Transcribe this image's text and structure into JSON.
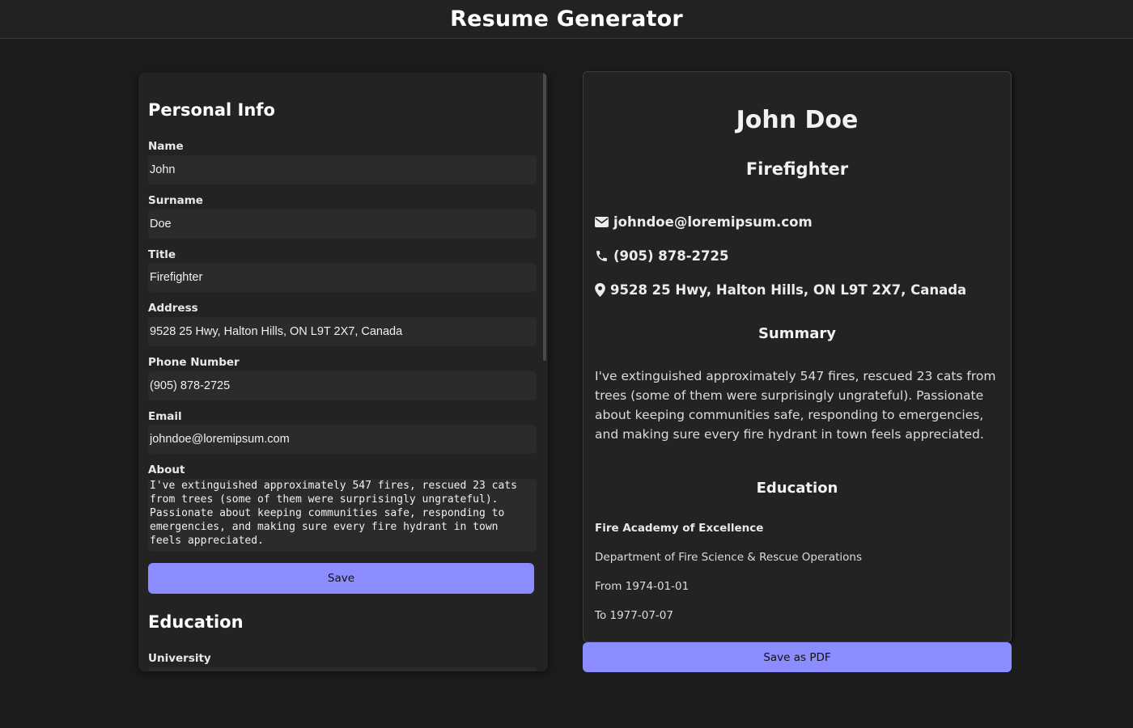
{
  "app": {
    "title": "Resume Generator"
  },
  "form": {
    "personal": {
      "heading": "Personal Info",
      "name_label": "Name",
      "name_value": "John",
      "surname_label": "Surname",
      "surname_value": "Doe",
      "title_label": "Title",
      "title_value": "Firefighter",
      "address_label": "Address",
      "address_value": "9528 25 Hwy, Halton Hills, ON L9T 2X7, Canada",
      "phone_label": "Phone Number",
      "phone_value": "(905) 878-2725",
      "email_label": "Email",
      "email_value": "johndoe@loremipsum.com",
      "about_label": "About",
      "about_value": "I've extinguished approximately 547 fires, rescued 23 cats from trees (some of them were surprisingly ungrateful). Passionate about keeping communities safe, responding to emergencies, and making sure every fire hydrant in town feels appreciated.",
      "save_label": "Save"
    },
    "education": {
      "heading": "Education",
      "university_label": "University"
    }
  },
  "preview": {
    "name": "John Doe",
    "title": "Firefighter",
    "email": "johndoe@loremipsum.com",
    "phone": "(905) 878-2725",
    "address": "9528 25 Hwy, Halton Hills, ON L9T 2X7, Canada",
    "summary_heading": "Summary",
    "summary": "I've extinguished approximately 547 fires, rescued 23 cats from trees (some of them were surprisingly ungrateful). Passionate about keeping communities safe, responding to emergencies, and making sure every fire hydrant in town feels appreciated.",
    "education_heading": "Education",
    "education": {
      "university": "Fire Academy of Excellence",
      "department": "Department of Fire Science & Rescue Operations",
      "from": "From 1974-01-01",
      "to": "To 1977-07-07"
    },
    "save_pdf_label": "Save as PDF"
  },
  "icons": {
    "email": "envelope-icon",
    "phone": "phone-icon",
    "address": "map-pin-icon"
  },
  "colors": {
    "accent": "#8b8cff",
    "background": "#1c1c1c",
    "panel": "#232323"
  }
}
